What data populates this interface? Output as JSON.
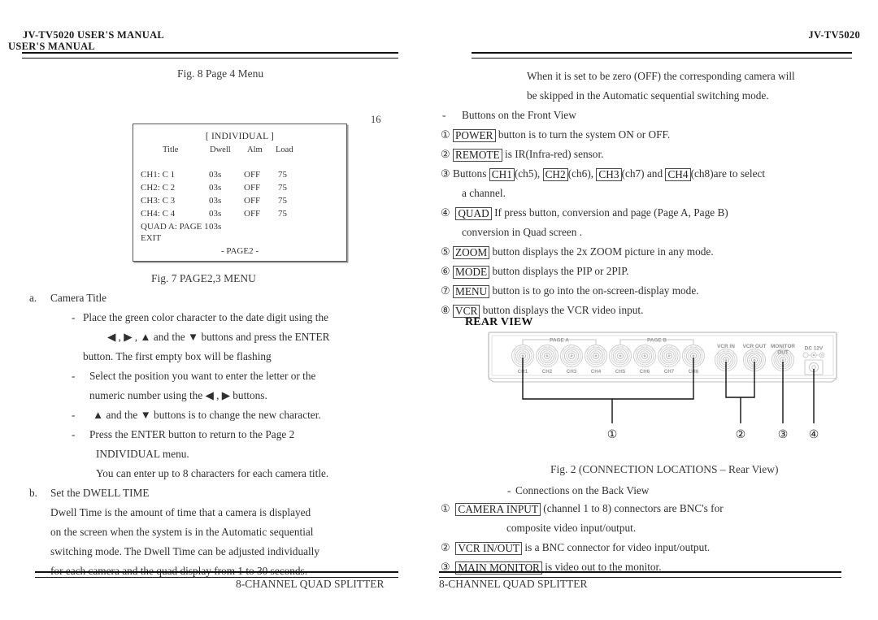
{
  "document": {
    "title": "JV-TV5020 USER'S MANUAL",
    "product": "JV-TV5020",
    "footer": "8-CHANNEL QUAD SPLITTER",
    "page_number": "16"
  },
  "left_column": {
    "running_head_line1": "JV-TV5020  USER'S  MANUAL",
    "running_head_line2": "USER'S MANUAL",
    "fig8_caption": "Fig. 8    Page 4 Menu",
    "fig7_caption": "Fig. 7    PAGE2,3 MENU",
    "osd": {
      "title": "[ INDIVIDUAL ]",
      "columns": [
        "Title",
        "Dwell",
        "Alm",
        "Load"
      ],
      "rows": [
        {
          "name": "CH1: C 1",
          "dwell": "03s",
          "alm": "OFF",
          "load": "75"
        },
        {
          "name": "CH2: C 2",
          "dwell": "03s",
          "alm": "OFF",
          "load": "75"
        },
        {
          "name": "CH3: C 3",
          "dwell": "03s",
          "alm": "OFF",
          "load": "75"
        },
        {
          "name": "CH4: C 4",
          "dwell": "03s",
          "alm": "OFF",
          "load": "75"
        },
        {
          "name": "QUAD A: PAGE 1",
          "dwell": "03s",
          "alm": "",
          "load": ""
        }
      ],
      "exit_label": "EXIT",
      "page_label": "- PAGE2 -"
    },
    "item_a": {
      "marker": "a.",
      "heading": "Camera Title",
      "bullets": [
        {
          "dash": "-",
          "line1_pre": "Place the green color character to the date digit using the",
          "line2_pre": "◀ , ▶ , ▲ and the ▼ buttons and press the ENTER",
          "line3": "button. The first empty box will be flashing"
        },
        {
          "dash": "-",
          "line1": "Select the position you want to enter the letter or the",
          "line2": "numeric number using the ◀ , ▶   buttons."
        },
        {
          "dash": "-",
          "line1": "▲ and the ▼  buttons is to change the new character."
        },
        {
          "dash": "-",
          "line1": "Press the ENTER button to return to the Page 2",
          "line2": "INDIVIDUAL menu."
        }
      ],
      "note": "You can enter up to 8 characters for each camera title."
    },
    "item_b": {
      "marker": "b.",
      "heading": "Set the DWELL TIME",
      "paragraph_lines": [
        "Dwell Time is the amount of time that a camera is displayed",
        "on the screen when the system is in the Automatic sequential",
        "switching mode. The Dwell Time can be adjusted individually",
        "for each camera and the quad display from 1 to 30 seconds."
      ]
    }
  },
  "right_column": {
    "running_head": "JV-TV5020",
    "intro_lines": [
      "When it is set to be zero (OFF) the corresponding camera will",
      "be skipped in the Automatic sequential switching mode."
    ],
    "front_view_dash": "-",
    "front_view_heading": "Buttons on the Front View",
    "front_items": [
      {
        "num": "①",
        "key": "POWER",
        "text": "button is to turn the system ON or OFF.",
        "cont": ""
      },
      {
        "num": "②",
        "key": "REMOTE",
        "text": "is IR(Infra-red) sensor.",
        "cont": ""
      },
      {
        "num": "③",
        "key": "",
        "text": "",
        "cont": "a channel.",
        "pre": "Buttons",
        "keys": [
          "CH1",
          "CH2",
          "CH3",
          "CH4"
        ],
        "between": [
          "(ch5),",
          "(ch6),",
          "(ch7) and",
          "(ch8)are to select"
        ]
      },
      {
        "num": "④",
        "key": "QUAD",
        "text": "If  press  button,  conversion  and  page  (Page A,  Page B)",
        "cont": "conversion in Quad screen ."
      },
      {
        "num": "⑤",
        "key": "ZOOM",
        "text": "button displays the 2x ZOOM picture in any mode.",
        "cont": ""
      },
      {
        "num": "⑥",
        "key": "MODE",
        "text": "button displays the PIP or 2PIP.",
        "cont": ""
      },
      {
        "num": "⑦",
        "key": "MENU",
        "text": "button is to go into the on-screen-display mode.",
        "cont": ""
      },
      {
        "num": "⑧",
        "key": "VCR",
        "text": "button displays the VCR video input.",
        "cont": ""
      }
    ],
    "rear_view_heading": "REAR VIEW",
    "rear_diagram": {
      "group_labels": [
        "PAGE A",
        "PAGE B"
      ],
      "bnc_labels": [
        "CH1",
        "CH2",
        "CH3",
        "CH4",
        "CH5",
        "CH6",
        "CH7",
        "CH8"
      ],
      "right_labels": [
        "VCR IN",
        "VCR OUT",
        "MONITOR",
        "OUT"
      ],
      "dc_label": "DC 12V",
      "callouts": [
        "①",
        "②",
        "③",
        "④"
      ]
    },
    "fig2_caption": "Fig. 2 (CONNECTION LOCATIONS – Rear View)",
    "back_view_dash": "-",
    "back_view_heading": "Connections on the Back View",
    "back_items": [
      {
        "num": "①",
        "key": "CAMERA  INPUT",
        "text": "(channel  1  to  8)  connectors  are  BNC's  for",
        "cont": "composite video input/output."
      },
      {
        "num": "②",
        "key": "VCR IN/OUT",
        "text": "is a BNC connector for video input/output.",
        "cont": ""
      },
      {
        "num": "③",
        "key": "MAIN MONITOR",
        "text": "is video out to the monitor.",
        "cont": ""
      }
    ]
  }
}
